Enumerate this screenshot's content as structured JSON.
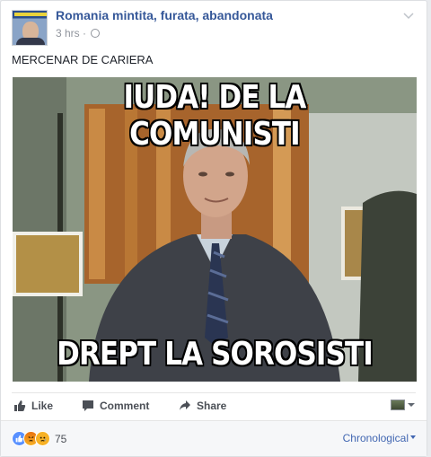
{
  "post": {
    "page_name": "Romania mintita, furata, abandonata",
    "time": "3 hrs",
    "separator": "·",
    "text": "MERCENAR DE CARIERA",
    "image": {
      "top_caption": "IUDA! DE LA COMUNISTI",
      "bottom_caption": "DREPT LA SOROSISTI"
    }
  },
  "actions": {
    "like": "Like",
    "comment": "Comment",
    "share": "Share"
  },
  "footer": {
    "reaction_count": "75",
    "sort_label": "Chronological"
  },
  "colors": {
    "link_blue": "#365899",
    "action_grey": "#4b4f56",
    "meta_grey": "#90949c"
  }
}
